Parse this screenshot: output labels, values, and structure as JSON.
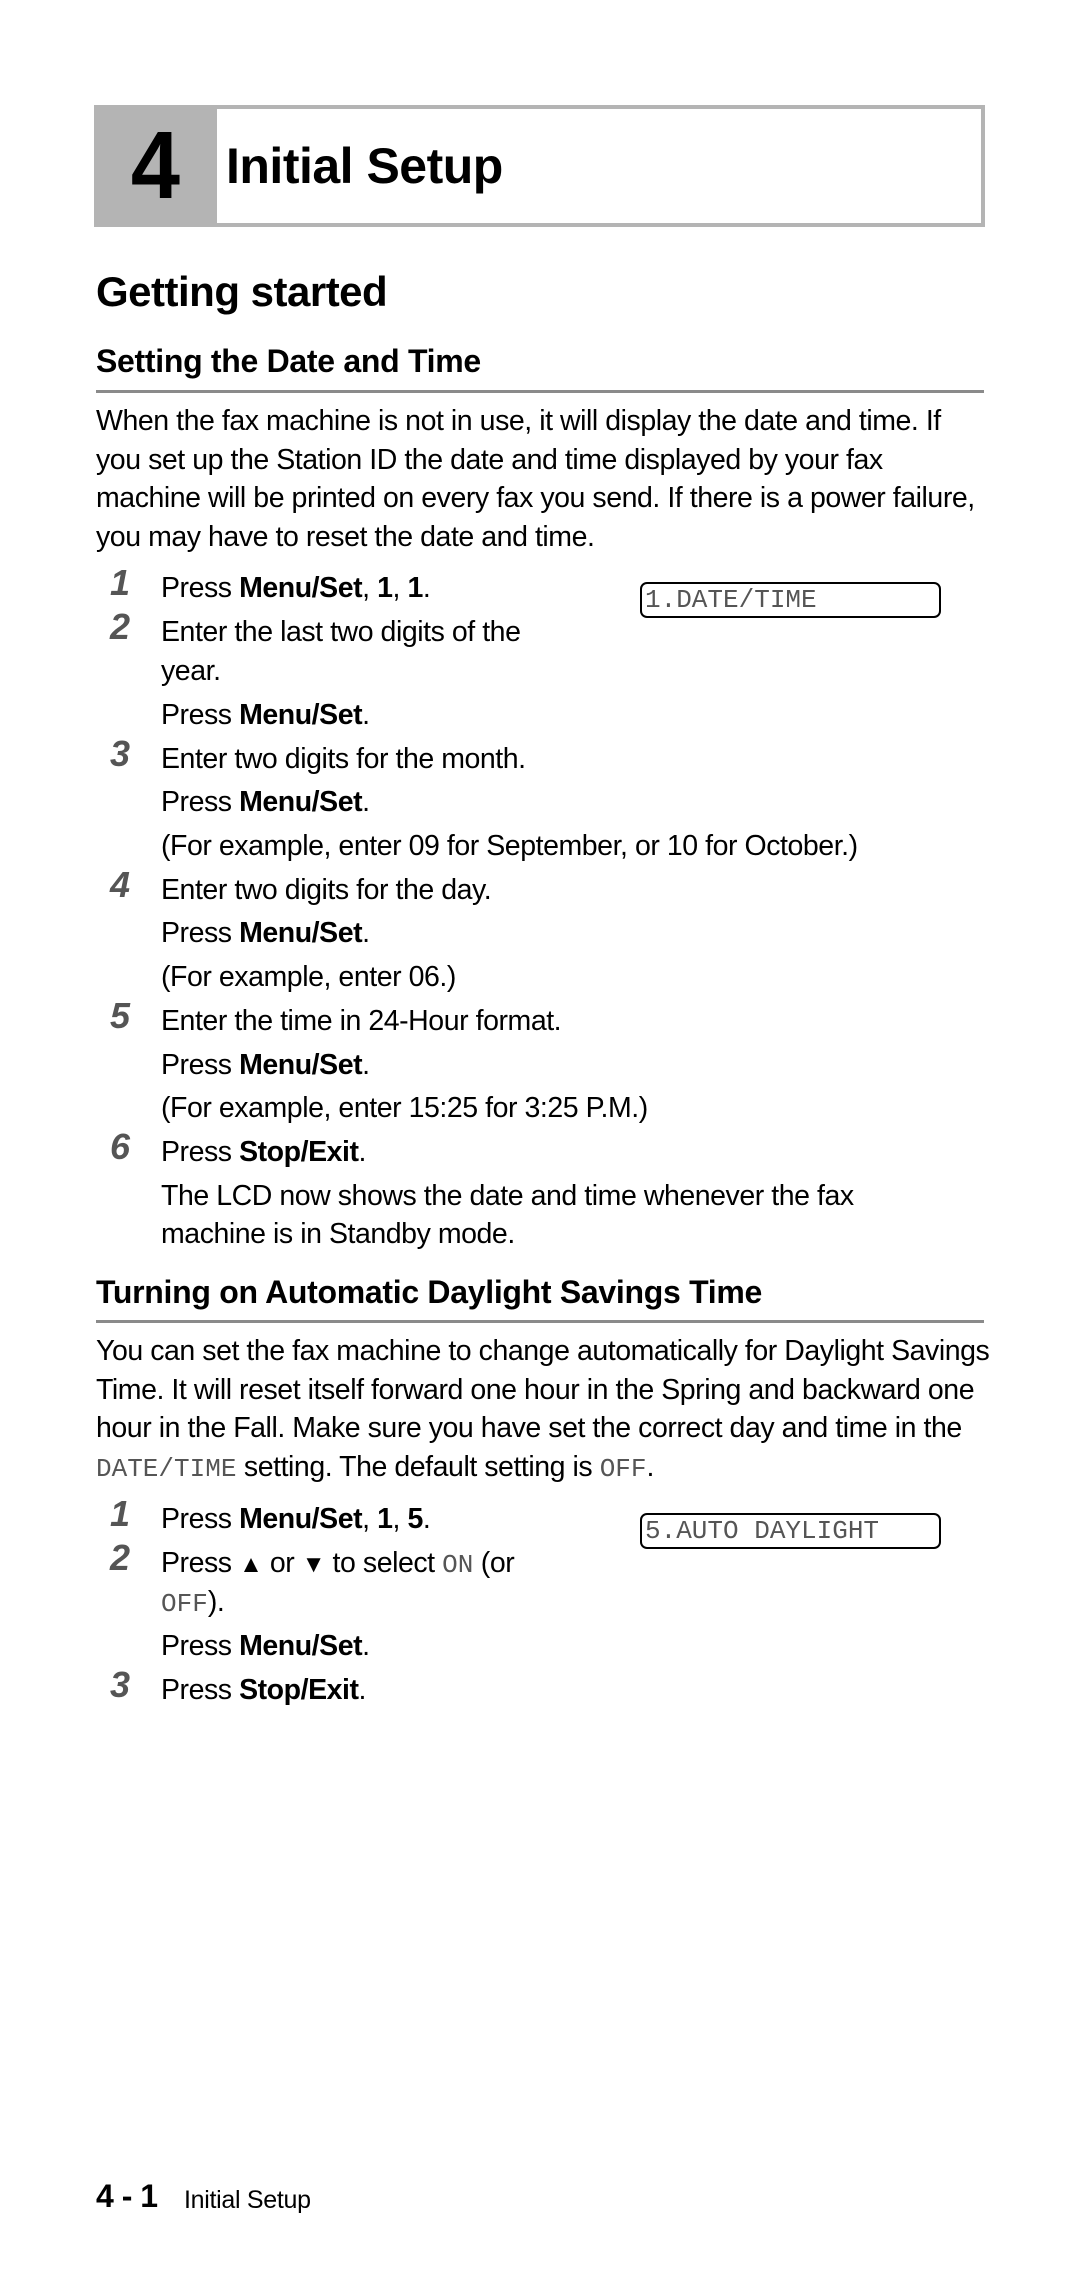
{
  "chapter": {
    "number": "4",
    "title": "Initial Setup"
  },
  "heading": "Getting started",
  "sections": [
    {
      "title": "Setting the Date and Time",
      "intro": "When the fax machine is not in use, it will display the date and time. If you set up the Station ID the date and time displayed by your fax machine will be printed on every fax you send. If there is a power failure, you may have to reset the date and time.",
      "lcd": "1.DATE/TIME",
      "steps": [
        {
          "num": "1",
          "lines": [
            {
              "pre": "Press ",
              "bold": "Menu/Set",
              "mid": ", ",
              "bold2": "1",
              "mid2": ", ",
              "bold3": "1",
              "post": "."
            }
          ]
        },
        {
          "num": "2",
          "lines": [
            {
              "text": "Enter the last two digits of the"
            },
            {
              "text": "year."
            },
            {
              "pre": "Press ",
              "bold": "Menu/Set",
              "post": "."
            }
          ]
        },
        {
          "num": "3",
          "lines": [
            {
              "text": "Enter two digits for the month."
            },
            {
              "pre": "Press ",
              "bold": "Menu/Set",
              "post": "."
            },
            {
              "text": "(For example, enter 09 for September, or 10 for October.)"
            }
          ]
        },
        {
          "num": "4",
          "lines": [
            {
              "text": "Enter two digits for the day."
            },
            {
              "pre": "Press ",
              "bold": "Menu/Set",
              "post": "."
            },
            {
              "text": "(For example, enter 06.)"
            }
          ]
        },
        {
          "num": "5",
          "lines": [
            {
              "text": "Enter the time in 24-Hour format."
            },
            {
              "pre": "Press ",
              "bold": "Menu/Set",
              "post": "."
            },
            {
              "text": "(For example, enter 15:25 for 3:25 P.M.)"
            }
          ]
        },
        {
          "num": "6",
          "lines": [
            {
              "pre": "Press ",
              "bold": "Stop/Exit",
              "post": "."
            },
            {
              "text": "The LCD now shows the date and time whenever the fax"
            },
            {
              "text": "machine is in Standby mode."
            }
          ]
        }
      ]
    },
    {
      "title": "Turning on Automatic Daylight Savings Time",
      "intro_parts": {
        "a": "You can set the fax machine to change automatically for Daylight Savings Time. It will reset itself forward one hour in the Spring and backward one hour in the Fall. Make sure you have set the correct day and time in the ",
        "code1": "DATE/TIME",
        "b": " setting. The default setting is ",
        "code2": "OFF",
        "c": "."
      },
      "lcd": "5.AUTO DAYLIGHT",
      "steps": [
        {
          "num": "1",
          "pre": "Press ",
          "bold": "Menu/Set",
          "mid": ", ",
          "bold2": "1",
          "mid2": ", ",
          "bold3": "5",
          "post": "."
        },
        {
          "num": "2",
          "pre": "Press ",
          "up": "▲",
          "or": " or ",
          "down": "▼",
          "mid": " to select ",
          "code_on": "ON",
          "post": " (or",
          "code_off": "OFF",
          "post2": ").",
          "line3_pre": "Press ",
          "line3_bold": "Menu/Set",
          "line3_post": "."
        },
        {
          "num": "3",
          "pre": "Press ",
          "bold": "Stop/Exit",
          "post": "."
        }
      ]
    }
  ],
  "footer": {
    "page": "4 - 1",
    "title": "Initial Setup"
  }
}
